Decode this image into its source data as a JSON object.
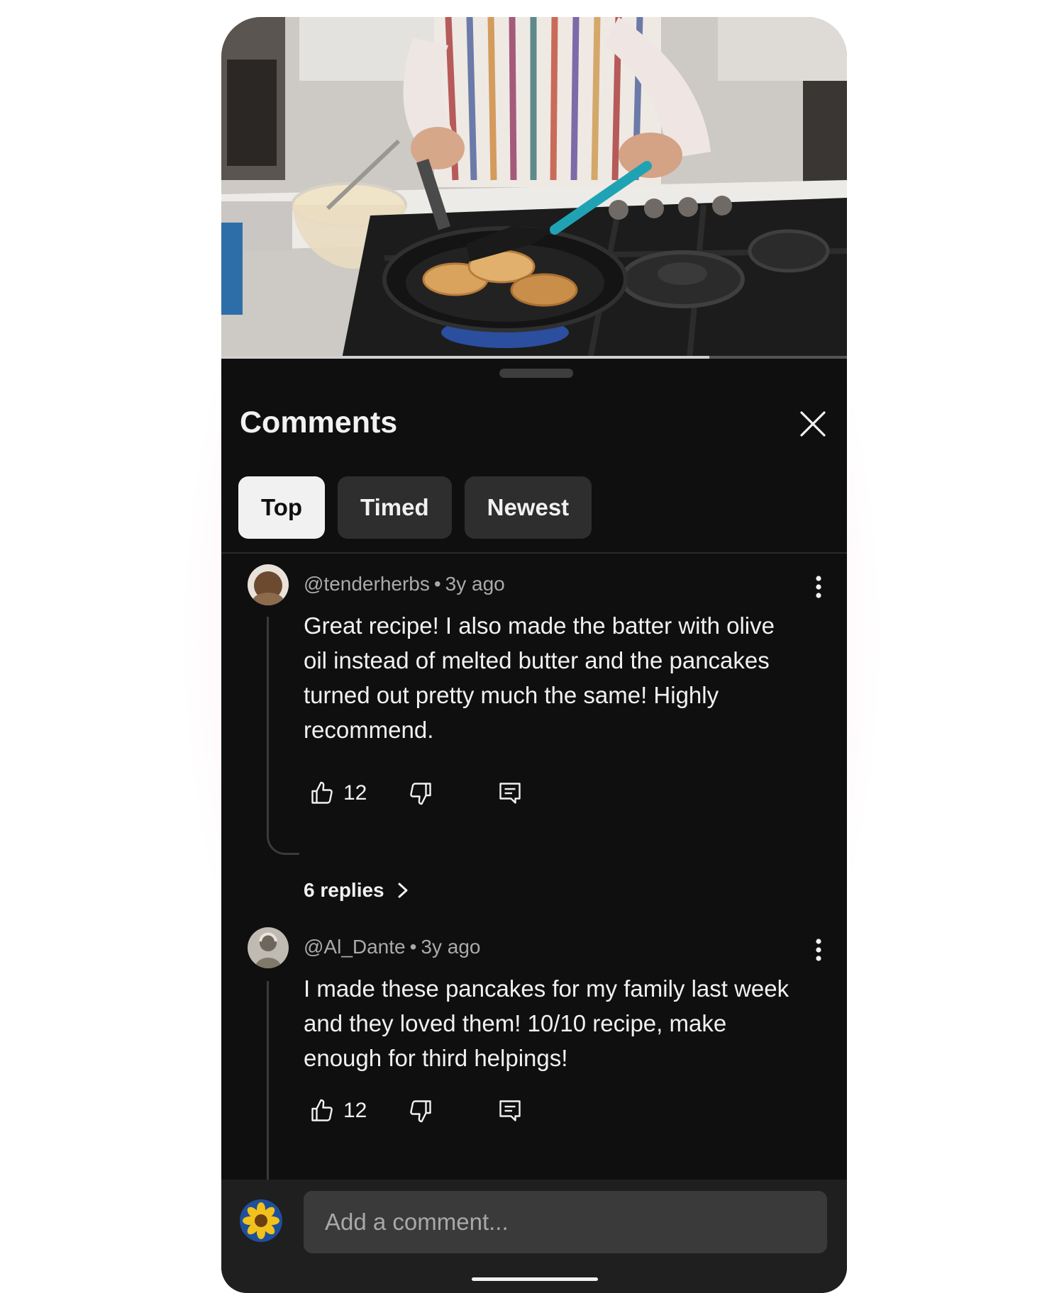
{
  "video": {
    "progress_fraction": 0.78,
    "scene": "cooking-pancakes-thumbnail"
  },
  "sheet": {
    "title": "Comments",
    "tabs": [
      {
        "label": "Top",
        "active": true
      },
      {
        "label": "Timed",
        "active": false
      },
      {
        "label": "Newest",
        "active": false
      }
    ]
  },
  "comments": [
    {
      "author": "@tenderherbs",
      "age": "3y ago",
      "text": "Great recipe! I also made the batter with olive oil instead of melted butter and the pancakes turned out pretty much the same! Highly recommend.",
      "likes": "12",
      "replies_label": "6 replies"
    },
    {
      "author": "@Al_Dante",
      "age": "3y ago",
      "text": "I made these pancakes for my family last week and they loved them! 10/10 recipe, make enough for third helpings!",
      "likes": "12"
    }
  ],
  "composer": {
    "placeholder": "Add a comment..."
  },
  "colors": {
    "sheet_bg": "#0f0f0f",
    "composer_bg": "#1f1f1f",
    "chip_active_bg": "#f1f1f1",
    "chip_bg": "#2e2e2e"
  }
}
